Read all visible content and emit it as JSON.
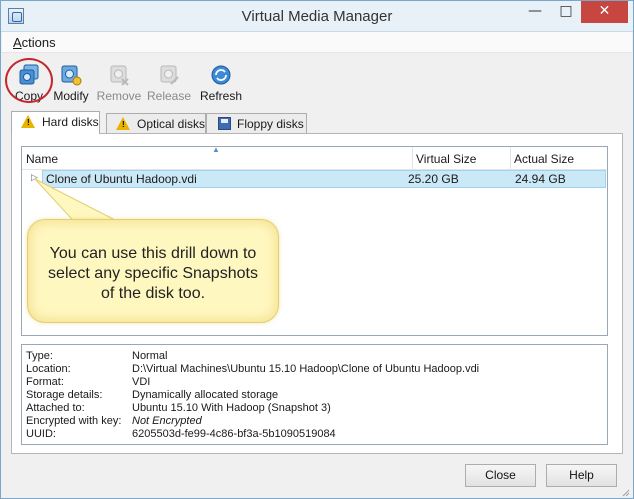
{
  "window": {
    "title": "Virtual Media Manager",
    "min_glyph": "—",
    "max_glyph": "□",
    "close_glyph": "✕",
    "icon": "virtualbox-media-icon"
  },
  "menubar": {
    "items": [
      {
        "label": "Actions",
        "accelerator": "A"
      }
    ]
  },
  "toolbar": {
    "items": [
      {
        "label": "Copy",
        "icon": "copy-disk-icon",
        "enabled": true,
        "highlighted": true
      },
      {
        "label": "Modify",
        "icon": "modify-disk-icon",
        "enabled": true
      },
      {
        "label": "Remove",
        "icon": "remove-disk-icon",
        "enabled": false
      },
      {
        "label": "Release",
        "icon": "release-disk-icon",
        "enabled": false
      },
      {
        "label": "Refresh",
        "icon": "refresh-icon",
        "enabled": true
      }
    ]
  },
  "tabs": [
    {
      "label": "Hard disks",
      "icon": "warning-icon",
      "active": true
    },
    {
      "label": "Optical disks",
      "icon": "warning-icon",
      "active": false
    },
    {
      "label": "Floppy disks",
      "icon": "floppy-icon",
      "active": false
    }
  ],
  "table": {
    "columns": [
      "Name",
      "Virtual Size",
      "Actual Size"
    ],
    "rows": [
      {
        "name": "Clone of Ubuntu Hadoop.vdi",
        "virtual_size": "25.20 GB",
        "actual_size": "24.94 GB",
        "selected": true
      }
    ]
  },
  "callout": {
    "text": "You can use this drill down to select any specific Snapshots of the disk too."
  },
  "details": [
    {
      "label": "Type:",
      "value": "Normal"
    },
    {
      "label": "Location:",
      "value": "D:\\Virtual Machines\\Ubuntu 15.10 Hadoop\\Clone of Ubuntu Hadoop.vdi"
    },
    {
      "label": "Format:",
      "value": "VDI"
    },
    {
      "label": "Storage details:",
      "value": "Dynamically allocated storage"
    },
    {
      "label": "Attached to:",
      "value": "Ubuntu 15.10 With Hadoop (Snapshot 3)"
    },
    {
      "label": "Encrypted with key:",
      "value": "Not Encrypted"
    },
    {
      "label": "UUID:",
      "value": "6205503d-fe99-4c86-bf3a-5b1090519084"
    }
  ],
  "buttons": {
    "close": "Close",
    "help": "Help"
  },
  "colors": {
    "selection": "#cbe8f6",
    "callout_fill": "#fff7c0",
    "highlight_ring": "#c2282e",
    "close_button": "#c7463f"
  }
}
